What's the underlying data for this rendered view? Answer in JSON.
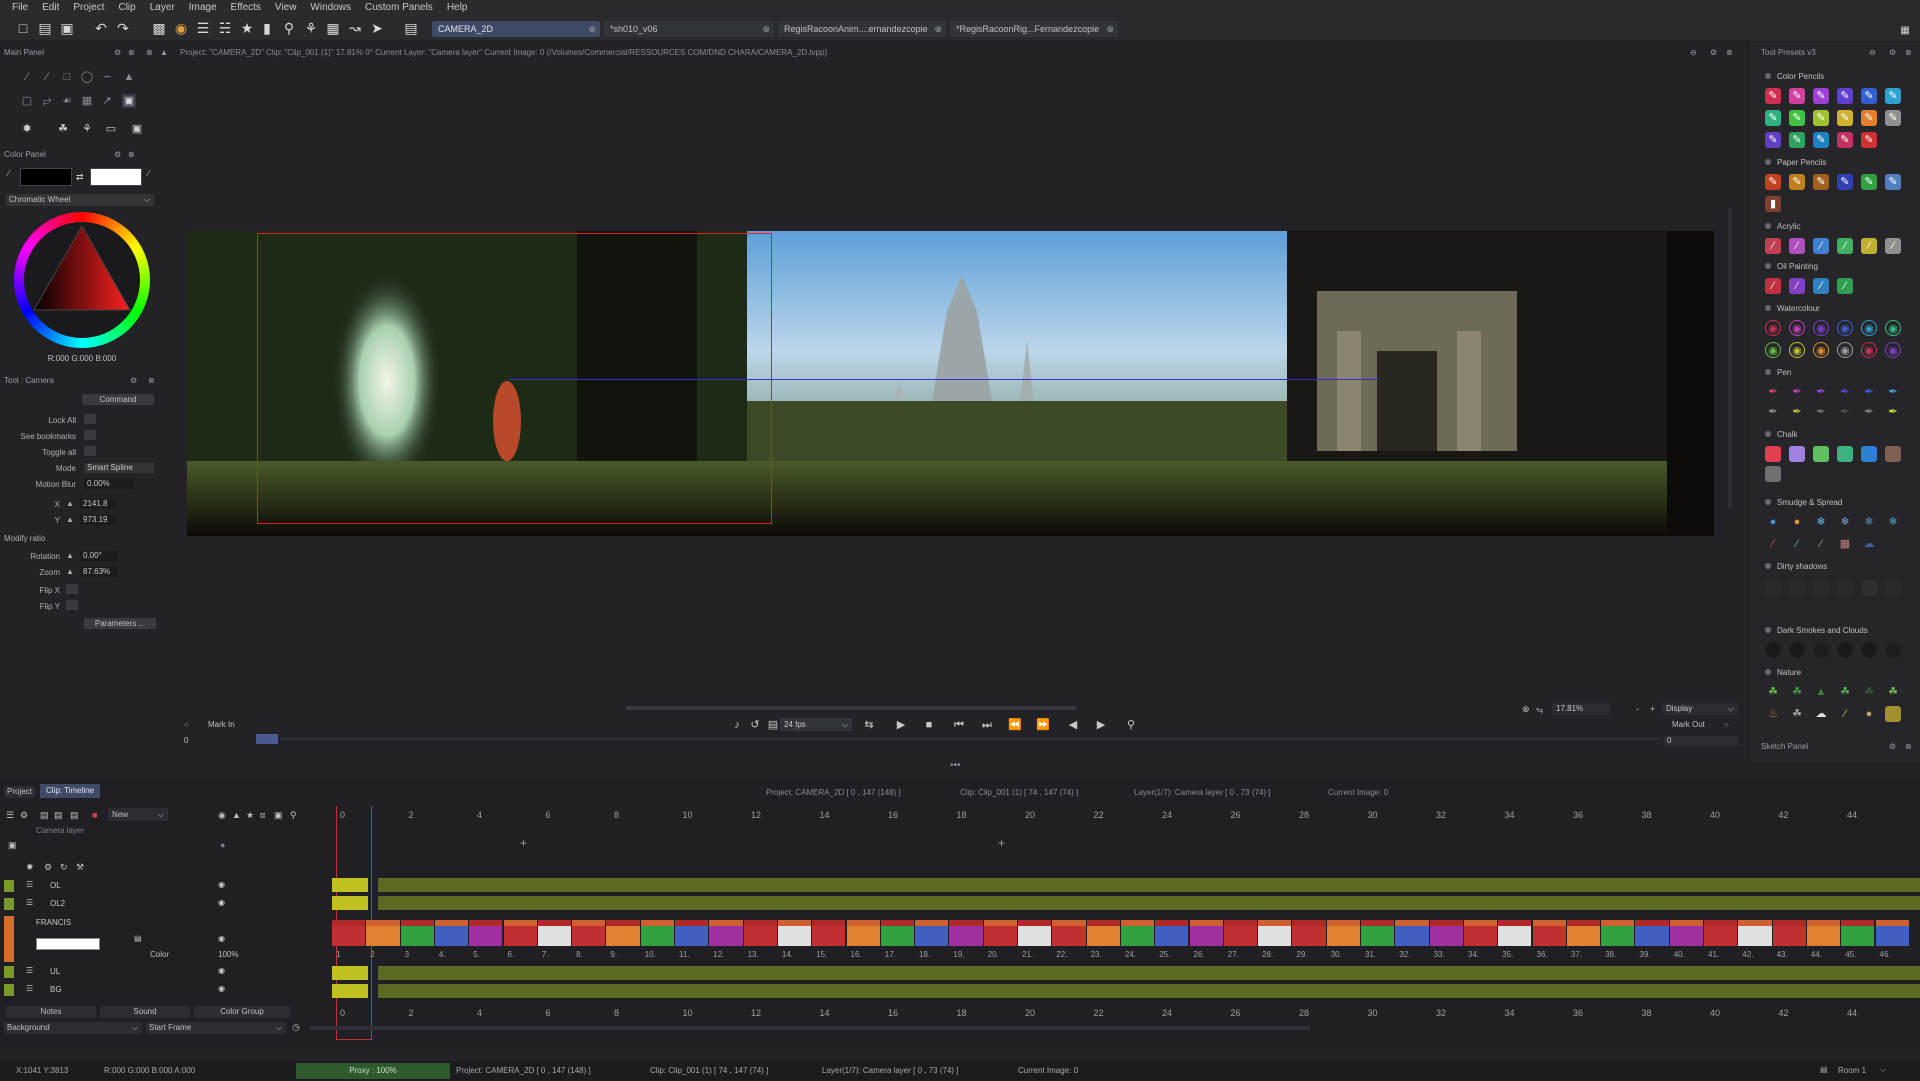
{
  "menu": [
    "File",
    "Edit",
    "Project",
    "Clip",
    "Layer",
    "Image",
    "Effects",
    "View",
    "Windows",
    "Custom Panels",
    "Help"
  ],
  "doc_tabs": [
    {
      "label": "CAMERA_2D",
      "active": true
    },
    {
      "label": "*sh010_v06",
      "active": false
    },
    {
      "label": "RegisRacoonAnim....ernandezcopie",
      "active": false
    },
    {
      "label": "*RegisRacoonRig...Fernandezcopie",
      "active": false
    }
  ],
  "main_panel": {
    "title": "Main Panel",
    "info": "Project: \"CAMERA_2D\"  Clip: \"Clip_001 (1)\"  17.81%  0°  Current Layer: \"Camera layer\"  Current Image: 0  (/Volumes/Commercial/RESSOURCES COM/DND CHARA/CAMERA_2D.tvpp)"
  },
  "color_panel": {
    "title": "Color Panel",
    "mode": "Chromatic Wheel",
    "rgb": "R:000 G:000 B:000",
    "colors": {
      "primary": "#000000",
      "secondary": "#ffffff"
    }
  },
  "tool_camera": {
    "title": "Tool : Camera",
    "command_btn": "Command",
    "lock_all": "Lock All",
    "see_bookmarks": "See bookmarks",
    "toggle_all": "Toggle all",
    "mode_label": "Mode",
    "mode_value": "Smart Spline",
    "motion_blur_label": "Motion Blur",
    "motion_blur_value": "0.00%",
    "x_label": "X",
    "x_value": "2141.8",
    "y_label": "Y",
    "y_value": "973.19",
    "modify_ratio": "Modify ratio",
    "rotation_label": "Rotation",
    "rotation_value": "0.00°",
    "zoom_label": "Zoom",
    "zoom_value": "87.63%",
    "flip_x": "Flip X",
    "flip_y": "Flip Y",
    "parameters_btn": "Parameters ..."
  },
  "tool_presets": {
    "title": "Tool Presets v3",
    "categories": [
      "Color Pencils",
      "Paper Pencils",
      "Acrylic",
      "Oil Painting",
      "Watercolour",
      "Pen",
      "Chalk",
      "Smudge & Spread",
      "Dirty shadows",
      "Dark Smokes and Clouds",
      "Nature"
    ],
    "sketch_panel": "Sketch Panel"
  },
  "playback": {
    "mark_in": "Mark In",
    "mark_in_value": "0",
    "fps": "24 fps",
    "zoom": "17.81%",
    "display": "Display",
    "mark_out": "Mark Out",
    "mark_out_value": "0"
  },
  "timeline": {
    "tabs": [
      "Project",
      "Clip: Timeline"
    ],
    "info_project": "Project: CAMERA_2D [ 0 , 147  (148) ]",
    "info_clip": "Clip: Clip_001 (1) [ 74 , 147  (74) ]",
    "info_layer": "Layer(1/7): Camera layer [ 0 , 73  (74) ]",
    "info_current": "Current Image: 0",
    "new_btn": "New",
    "camera_layer": "Camera layer",
    "layers": [
      "OL",
      "OL2",
      "FRANCIS",
      "UL",
      "BG"
    ],
    "color_label": "Color",
    "opacity": "100%",
    "frame_ruler": [
      "0",
      "2",
      "4",
      "6",
      "8",
      "10",
      "12",
      "14",
      "16",
      "18",
      "20",
      "22",
      "24",
      "26",
      "28",
      "30",
      "32",
      "34",
      "36",
      "38",
      "40",
      "42",
      "44"
    ],
    "francis_frames": [
      "1",
      "2",
      "3",
      "4.",
      "5.",
      "6.",
      "7.",
      "8.",
      "9.",
      "10.",
      "11.",
      "12.",
      "13.",
      "14.",
      "15.",
      "16.",
      "17.",
      "18.",
      "19.",
      "20.",
      "21.",
      "22.",
      "23.",
      "24.",
      "25.",
      "26.",
      "27.",
      "28.",
      "29.",
      "30.",
      "31.",
      "32.",
      "33.",
      "34.",
      "35.",
      "36.",
      "37.",
      "38.",
      "39.",
      "40.",
      "41.",
      "42.",
      "43.",
      "44.",
      "45.",
      "46."
    ],
    "bottom_tabs": [
      "Notes",
      "Sound",
      "Color Group"
    ],
    "background_select": "Background",
    "start_frame": "Start Frame"
  },
  "status": {
    "coords": "X:1041  Y:3813",
    "rgba": "R:000 G:000 B:000 A:000",
    "proxy": "Proxy : 100%",
    "project": "Project: CAMERA_2D [ 0 , 147  (148) ]",
    "clip": "Clip: Clip_001 (1) [ 74 , 147  (74) ]",
    "layer": "Layer(1/7): Camera layer [ 0 , 73  (74) ]",
    "current": "Current Image: 0",
    "room": "Room 1"
  }
}
